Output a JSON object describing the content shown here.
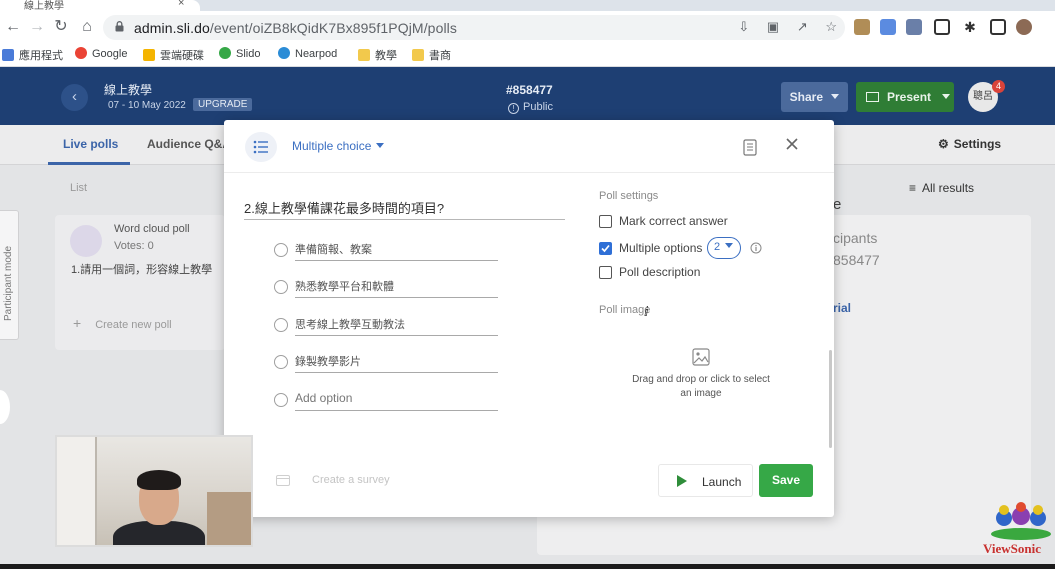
{
  "browser": {
    "tab_title": "線上教學",
    "tab_close": "×",
    "url_host": "admin.sli.do",
    "url_path": "/event/oiZB8kQidK7Bx895f1PQjM/polls",
    "bookmarks": [
      {
        "label": "應用程式",
        "color": "#4a7bd8"
      },
      {
        "label": "Google",
        "color": "#ea4335"
      },
      {
        "label": "雲端硬碟",
        "color": "#f4b400"
      },
      {
        "label": "Slido",
        "color": "#36a847"
      },
      {
        "label": "Nearpod",
        "color": "#2b8cd6"
      },
      {
        "label": "教學",
        "color": "#f2c94c"
      },
      {
        "label": "書商",
        "color": "#f2c94c"
      }
    ]
  },
  "header": {
    "event_name": "線上教學",
    "event_dates": "07 - 10 May 2022",
    "upgrade_label": "UPGRADE",
    "event_code": "#858477",
    "visibility": "Public",
    "share_label": "Share",
    "present_label": "Present",
    "avatar_text": "聰呂",
    "notification_count": "4"
  },
  "tabs": {
    "live_polls": "Live polls",
    "audience_qa": "Audience Q&A",
    "settings": "Settings"
  },
  "background": {
    "list_label": "List",
    "all_results": "All results",
    "participant_mode": "Participant mode",
    "poll_card": {
      "title": "Word cloud poll",
      "votes": "Votes: 0",
      "question": "1.請用一個詞，形容線上教學"
    },
    "create_new_poll": "Create new poll",
    "right_e": "e",
    "right_participants": "cipants",
    "right_code": "858477",
    "right_rial": "rial"
  },
  "modal": {
    "type_label": "Multiple choice",
    "question": "2.線上教學備課花最多時間的項目?",
    "options": [
      "準備簡報、教案",
      "熟悉教學平台和軟體",
      "思考線上教學互動教法",
      "錄製教學影片"
    ],
    "add_option_placeholder": "Add option",
    "poll_settings_title": "Poll settings",
    "mark_correct_answer": "Mark correct answer",
    "multiple_options": "Multiple options",
    "multiple_options_checked": true,
    "multiple_options_count": "2",
    "poll_description": "Poll description",
    "poll_image_title": "Poll image",
    "drop_text": "Drag and drop or click to select an image",
    "create_survey": "Create a survey",
    "launch_label": "Launch",
    "save_label": "Save"
  },
  "logo": {
    "text": "ViewSonic"
  },
  "colors": {
    "app_header": "#1e3f73",
    "accent_blue": "#3b6fc2",
    "save_green": "#36a847",
    "present_green": "#2f7d35"
  }
}
